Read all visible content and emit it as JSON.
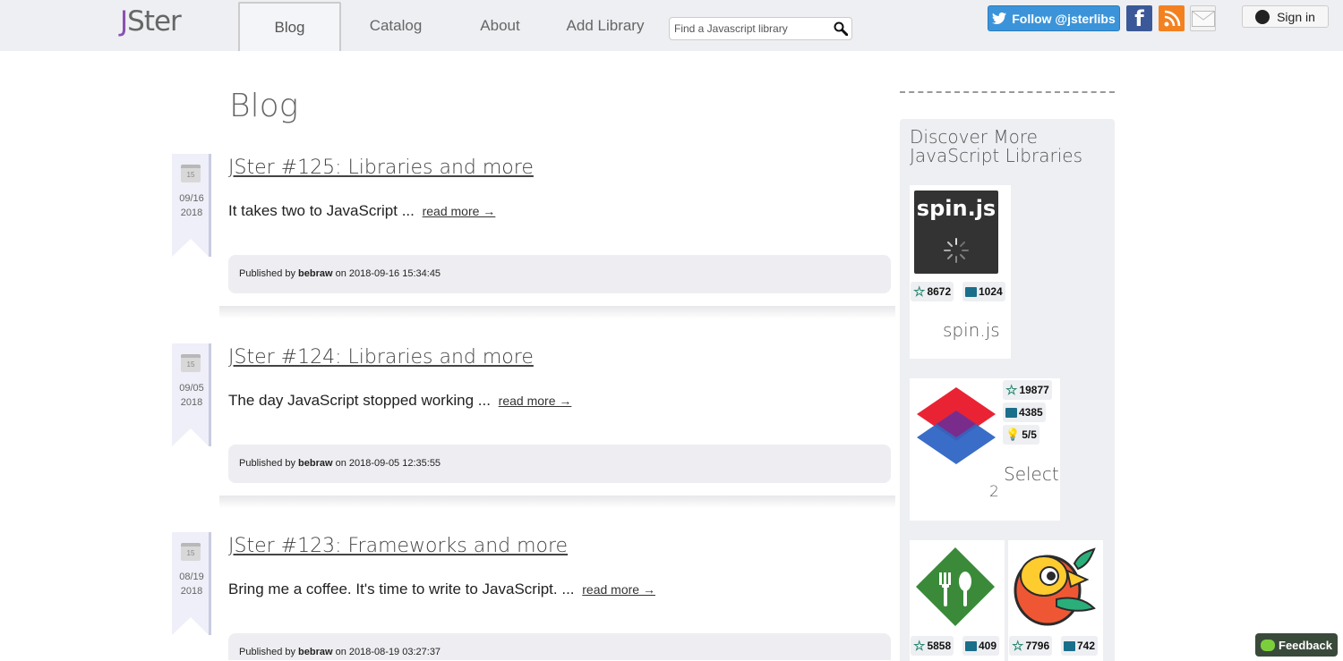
{
  "header": {
    "logo_j": "J",
    "logo_rest": "Ster",
    "nav": [
      {
        "label": "Blog"
      },
      {
        "label": "Catalog"
      },
      {
        "label": "About"
      },
      {
        "label": "Add Library"
      }
    ],
    "search_placeholder": "Find a Javascript library",
    "follow_label": "Follow @jsterlibs",
    "signin_label": "Sign in"
  },
  "main": {
    "title": "Blog",
    "posts": [
      {
        "title": "JSter #125: Libraries and more",
        "excerpt": "It takes two to JavaScript ...",
        "read_more": "read more →",
        "date_md": "09/16",
        "date_y": "2018",
        "cal_day": "15",
        "published_prefix": "Published by ",
        "author": "bebraw",
        "published_suffix": " on 2018-09-16 15:34:45"
      },
      {
        "title": "JSter #124: Libraries and more",
        "excerpt": "The day JavaScript stopped working ...",
        "read_more": "read more →",
        "date_md": "09/05",
        "date_y": "2018",
        "cal_day": "15",
        "published_prefix": "Published by ",
        "author": "bebraw",
        "published_suffix": " on 2018-09-05 12:35:55"
      },
      {
        "title": "JSter #123: Frameworks and more",
        "excerpt": "Bring me a coffee. It's time to write to JavaScript. ...",
        "read_more": "read more →",
        "date_md": "08/19",
        "date_y": "2018",
        "cal_day": "15",
        "published_prefix": "Published by ",
        "author": "bebraw",
        "published_suffix": " on 2018-08-19 03:27:37"
      }
    ]
  },
  "sidebar": {
    "title": "Discover More JavaScript Libraries",
    "libraries": [
      {
        "name": "spin.js",
        "logo_text": "spin.js",
        "stars": "8672",
        "forks": "1024"
      },
      {
        "name": "Select 2",
        "name_line1": "Select",
        "name_line2": "2",
        "stars": "19877",
        "forks": "4385",
        "rating": "5/5"
      },
      {
        "stars": "5858",
        "forks": "409"
      },
      {
        "stars": "7796",
        "forks": "742"
      }
    ]
  },
  "feedback_label": "Feedback",
  "colors": {
    "header_bg": "#eeeff2",
    "logo_accent": "#8a4fb3",
    "twitter": "#3b94d9",
    "facebook": "#3b5998",
    "rss": "#f48120"
  }
}
